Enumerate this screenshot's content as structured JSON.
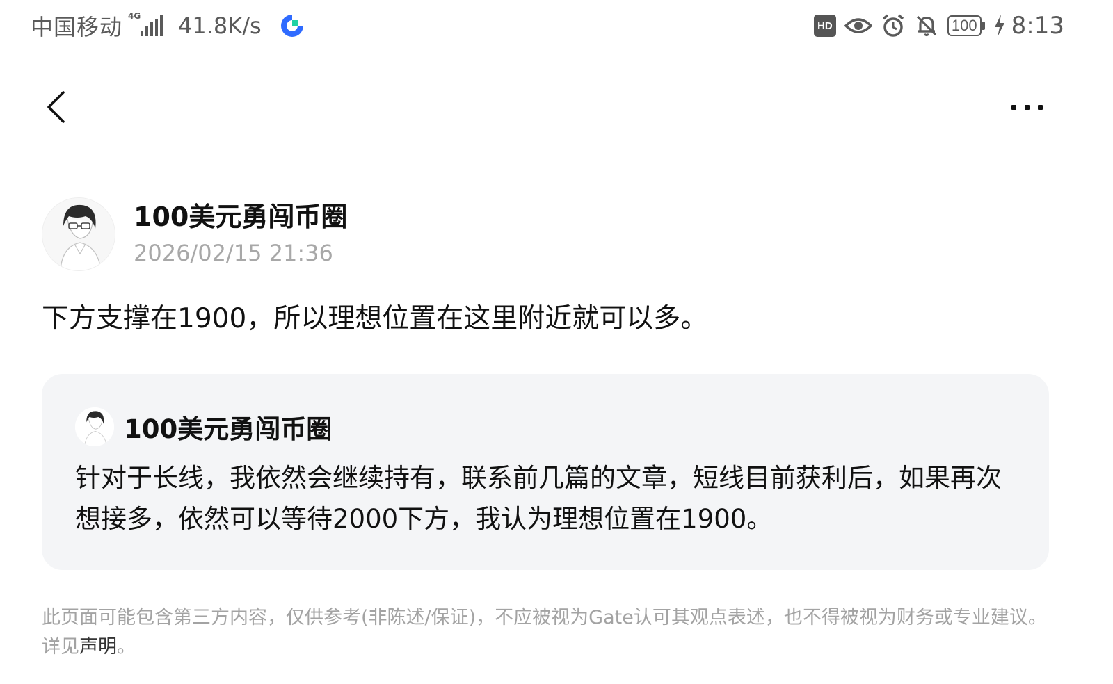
{
  "status_bar": {
    "carrier": "中国移动",
    "network_tag": "4G",
    "net_speed": "41.8K/s",
    "hd_label": "HD",
    "battery": "100",
    "time": "8:13",
    "icons": [
      "hd-icon",
      "eye-icon",
      "alarm-icon",
      "bell-off-icon",
      "battery-icon",
      "charging-icon"
    ]
  },
  "nav": {
    "back_icon": "chevron-left-icon",
    "more_icon": "more-dots-icon"
  },
  "post": {
    "author": "100美元勇闯币圈",
    "timestamp": "2026/02/15 21:36",
    "content": "下方支撑在1900，所以理想位置在这里附近就可以多。"
  },
  "quoted_post": {
    "author": "100美元勇闯币圈",
    "content": "针对于长线，我依然会继续持有，联系前几篇的文章，短线目前获利后，如果再次想接多，依然可以等待2000下方，我认为理想位置在1900。"
  },
  "disclaimer": {
    "text": "此页面可能包含第三方内容，仅供参考(非陈述/保证)，不应被视为Gate认可其观点表述，也不得被视为财务或专业建议。详见",
    "link_label": "声明",
    "suffix": "。"
  },
  "colors": {
    "text_primary": "#111111",
    "text_secondary": "#a8a8a8",
    "card_bg": "#f4f5f7",
    "statusbar_text": "#5a5a5a",
    "app_icon_blue": "#2f6bff",
    "app_icon_green": "#1fd1a5"
  }
}
